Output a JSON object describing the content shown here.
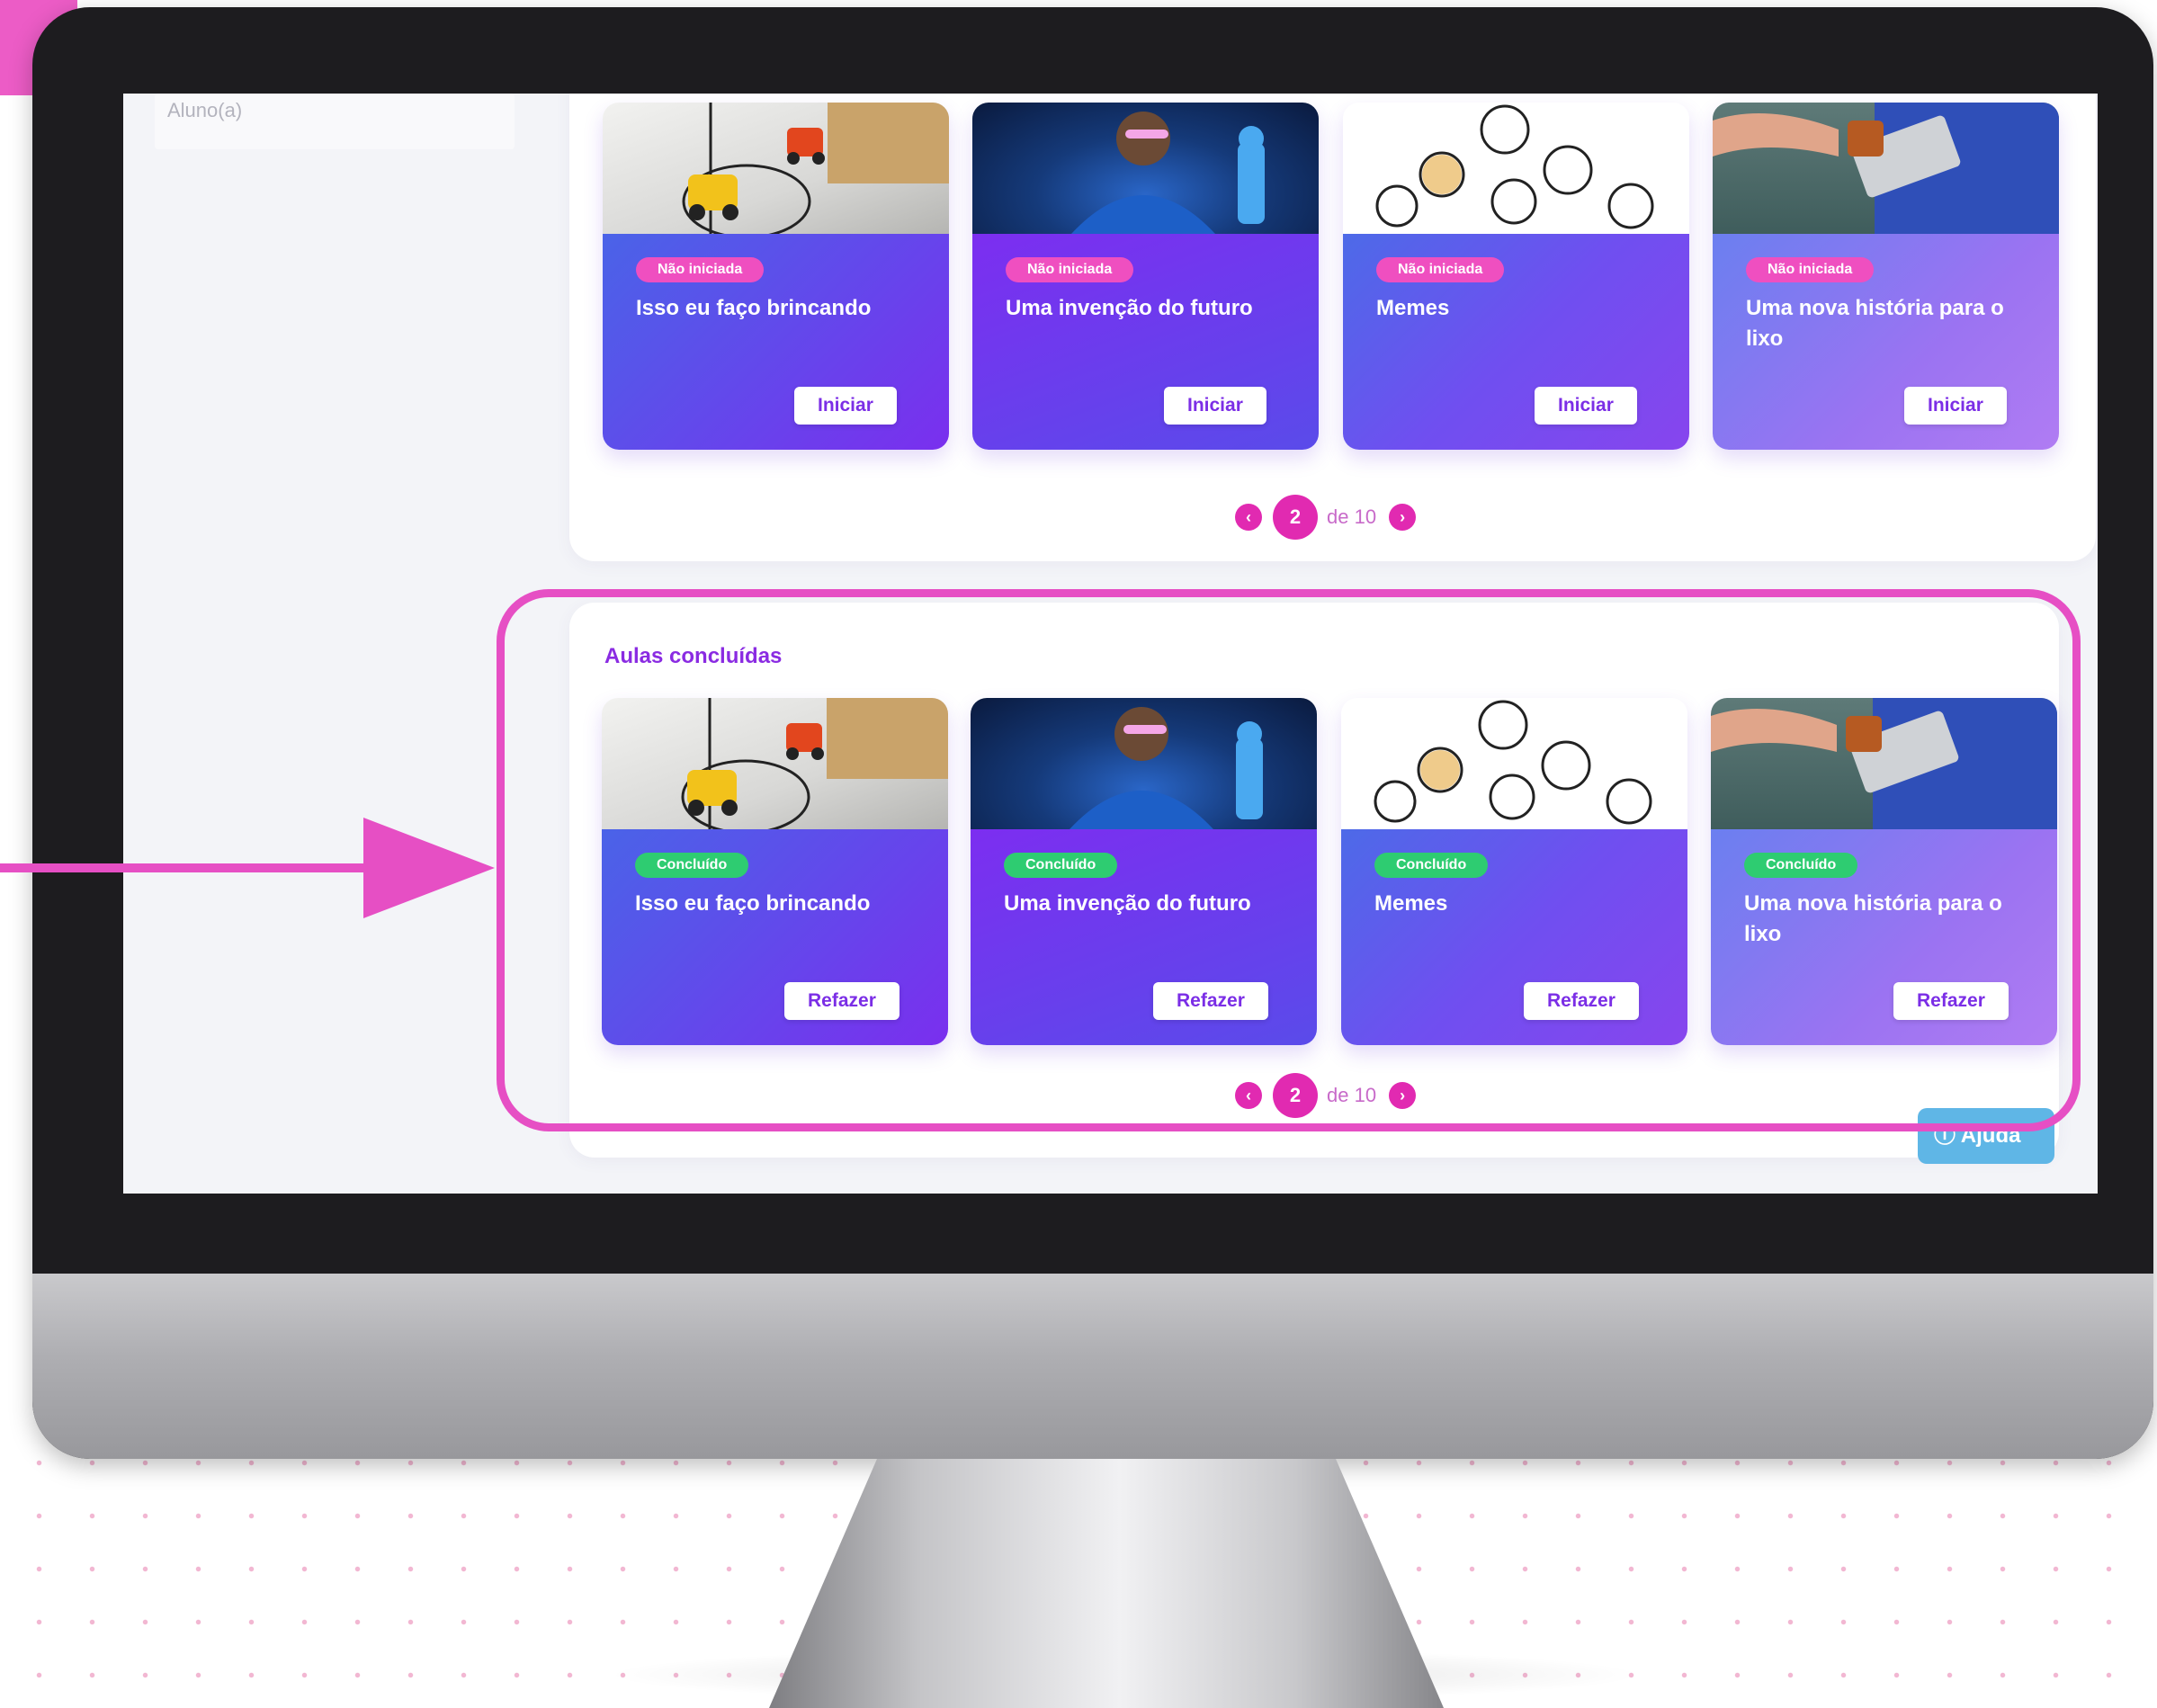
{
  "sidebar": {
    "user_role": "Aluno(a)"
  },
  "pending_section": {
    "cards": [
      {
        "badge": "Não iniciada",
        "title": "Isso eu faço brincando",
        "button": "Iniciar"
      },
      {
        "badge": "Não iniciada",
        "title": "Uma invenção do futuro",
        "button": "Iniciar"
      },
      {
        "badge": "Não iniciada",
        "title": "Memes",
        "button": "Iniciar"
      },
      {
        "badge": "Não iniciada",
        "title": "Uma nova história para o lixo",
        "button": "Iniciar"
      }
    ],
    "pagination": {
      "prev": "‹",
      "page": "2",
      "of": "de 10",
      "next": "›"
    }
  },
  "completed_section": {
    "title": "Aulas concluídas",
    "cards": [
      {
        "badge": "Concluído",
        "title": "Isso eu faço brincando",
        "button": "Refazer"
      },
      {
        "badge": "Concluído",
        "title": "Uma invenção do futuro",
        "button": "Refazer"
      },
      {
        "badge": "Concluído",
        "title": "Memes",
        "button": "Refazer"
      },
      {
        "badge": "Concluído",
        "title": "Uma nova história para o lixo",
        "button": "Refazer"
      }
    ],
    "pagination": {
      "prev": "‹",
      "page": "2",
      "of": "de 10",
      "next": "›"
    }
  },
  "help_button": {
    "icon": "ⓘ",
    "label": "Ajuda"
  },
  "colors": {
    "accent_pink": "#e12ab1",
    "highlight_pink": "#e64fc4",
    "badge_pending": "#ef4fc0",
    "badge_done": "#2ecc71",
    "section_title": "#8a2be2"
  }
}
